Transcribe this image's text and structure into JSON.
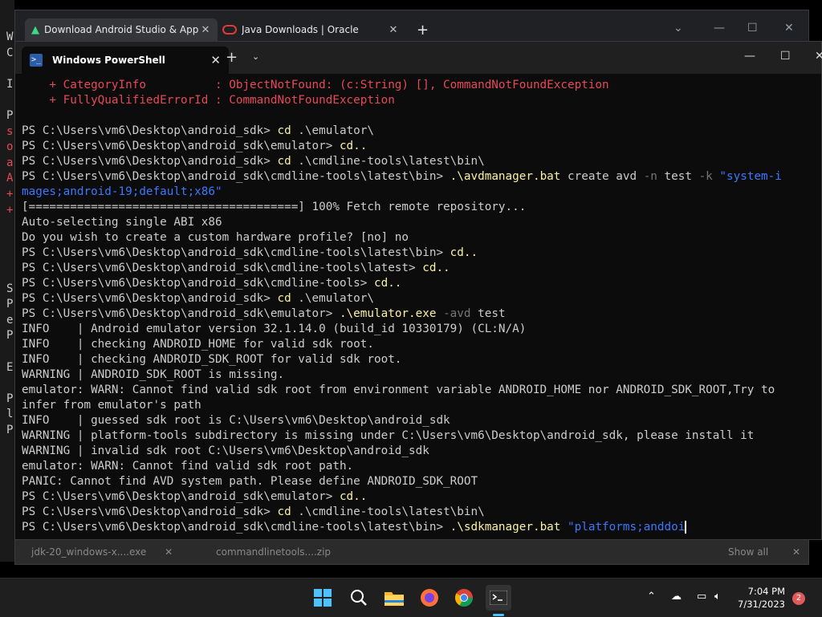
{
  "desktop_fragment_left": [
    "W",
    "C",
    "",
    "I",
    "",
    "P",
    "s",
    "o",
    "a",
    "A",
    "+",
    "+",
    "",
    "",
    "",
    "",
    "S",
    "P",
    "e",
    "P",
    "",
    "E",
    "",
    "P",
    "l",
    "P"
  ],
  "browser": {
    "tabs": [
      {
        "label": "Download Android Studio & App"
      },
      {
        "label": "Java Downloads | Oracle"
      }
    ],
    "downloads": [
      {
        "label": "jdk-20_windows-x....exe"
      },
      {
        "label": "commandlinetools....zip"
      }
    ],
    "show_all": "Show all"
  },
  "terminal": {
    "tab_title": "Windows PowerShell",
    "icon": "powershell-icon",
    "lines": [
      [
        {
          "t": "    + CategoryInfo          : ObjectNotFound: (c:String) [], CommandNotFoundException",
          "c": "red"
        }
      ],
      [
        {
          "t": "    + FullyQualifiedErrorId : CommandNotFoundException",
          "c": "red"
        }
      ],
      [
        {
          "t": ""
        }
      ],
      [
        {
          "t": "PS C:\\Users\\vm6\\Desktop\\android_sdk> "
        },
        {
          "t": "cd",
          "c": "yel"
        },
        {
          "t": " .\\emulator\\"
        }
      ],
      [
        {
          "t": "PS C:\\Users\\vm6\\Desktop\\android_sdk\\emulator> "
        },
        {
          "t": "cd..",
          "c": "yel"
        }
      ],
      [
        {
          "t": "PS C:\\Users\\vm6\\Desktop\\android_sdk> "
        },
        {
          "t": "cd",
          "c": "yel"
        },
        {
          "t": " .\\cmdline-tools\\latest\\bin\\"
        }
      ],
      [
        {
          "t": "PS C:\\Users\\vm6\\Desktop\\android_sdk\\cmdline-tools\\latest\\bin> "
        },
        {
          "t": ".\\avdmanager.bat",
          "c": "yel"
        },
        {
          "t": " create avd "
        },
        {
          "t": "-n",
          "c": "gry"
        },
        {
          "t": " test "
        },
        {
          "t": "-k",
          "c": "gry"
        },
        {
          "t": " "
        },
        {
          "t": "\"system-i",
          "c": "blu"
        }
      ],
      [
        {
          "t": "mages;android-19;default;x86\"",
          "c": "blu"
        }
      ],
      [
        {
          "t": "[=======================================] 100% Fetch remote repository..."
        }
      ],
      [
        {
          "t": "Auto-selecting single ABI x86"
        }
      ],
      [
        {
          "t": "Do you wish to create a custom hardware profile? [no] no"
        }
      ],
      [
        {
          "t": "PS C:\\Users\\vm6\\Desktop\\android_sdk\\cmdline-tools\\latest\\bin> "
        },
        {
          "t": "cd..",
          "c": "yel"
        }
      ],
      [
        {
          "t": "PS C:\\Users\\vm6\\Desktop\\android_sdk\\cmdline-tools\\latest> "
        },
        {
          "t": "cd..",
          "c": "yel"
        }
      ],
      [
        {
          "t": "PS C:\\Users\\vm6\\Desktop\\android_sdk\\cmdline-tools> "
        },
        {
          "t": "cd..",
          "c": "yel"
        }
      ],
      [
        {
          "t": "PS C:\\Users\\vm6\\Desktop\\android_sdk> "
        },
        {
          "t": "cd",
          "c": "yel"
        },
        {
          "t": " .\\emulator\\"
        }
      ],
      [
        {
          "t": "PS C:\\Users\\vm6\\Desktop\\android_sdk\\emulator> "
        },
        {
          "t": ".\\emulator.exe",
          "c": "yel"
        },
        {
          "t": " "
        },
        {
          "t": "-avd",
          "c": "gry"
        },
        {
          "t": " test"
        }
      ],
      [
        {
          "t": "INFO    | Android emulator version 32.1.14.0 (build_id 10330179) (CL:N/A)"
        }
      ],
      [
        {
          "t": "INFO    | checking ANDROID_HOME for valid sdk root."
        }
      ],
      [
        {
          "t": "INFO    | checking ANDROID_SDK_ROOT for valid sdk root."
        }
      ],
      [
        {
          "t": "WARNING | ANDROID_SDK_ROOT is missing."
        }
      ],
      [
        {
          "t": "emulator: WARN: Cannot find valid sdk root from environment variable ANDROID_HOME nor ANDROID_SDK_ROOT,Try to"
        }
      ],
      [
        {
          "t": "infer from emulator's path"
        }
      ],
      [
        {
          "t": "INFO    | guessed sdk root is C:\\Users\\vm6\\Desktop\\android_sdk"
        }
      ],
      [
        {
          "t": "WARNING | platform-tools subdirectory is missing under C:\\Users\\vm6\\Desktop\\android_sdk, please install it"
        }
      ],
      [
        {
          "t": "WARNING | invalid sdk root C:\\Users\\vm6\\Desktop\\android_sdk"
        }
      ],
      [
        {
          "t": "emulator: WARN: Cannot find valid sdk root path."
        }
      ],
      [
        {
          "t": "PANIC: Cannot find AVD system path. Please define ANDROID_SDK_ROOT"
        }
      ],
      [
        {
          "t": "PS C:\\Users\\vm6\\Desktop\\android_sdk\\emulator> "
        },
        {
          "t": "cd..",
          "c": "yel"
        }
      ],
      [
        {
          "t": "PS C:\\Users\\vm6\\Desktop\\android_sdk> "
        },
        {
          "t": "cd",
          "c": "yel"
        },
        {
          "t": " .\\cmdline-tools\\latest\\bin\\"
        }
      ],
      [
        {
          "t": "PS C:\\Users\\vm6\\Desktop\\android_sdk\\cmdline-tools\\latest\\bin> "
        },
        {
          "t": ".\\sdkmanager.bat",
          "c": "yel"
        },
        {
          "t": " "
        },
        {
          "t": "\"platforms;anddoi",
          "c": "blu"
        },
        {
          "cursor": true
        }
      ]
    ]
  },
  "taskbar": {
    "icons": [
      "windows-start-icon",
      "search-icon",
      "file-explorer-icon",
      "firefox-icon",
      "chrome-icon",
      "terminal-icon"
    ],
    "time": "7:04 PM",
    "date": "7/31/2023",
    "notification_count": "2"
  },
  "colors": {
    "red": "#e74856",
    "yel": "#f9f1a5",
    "gry": "#767676",
    "blu": "#3b78ff",
    "accent": "#4cc2ff"
  }
}
